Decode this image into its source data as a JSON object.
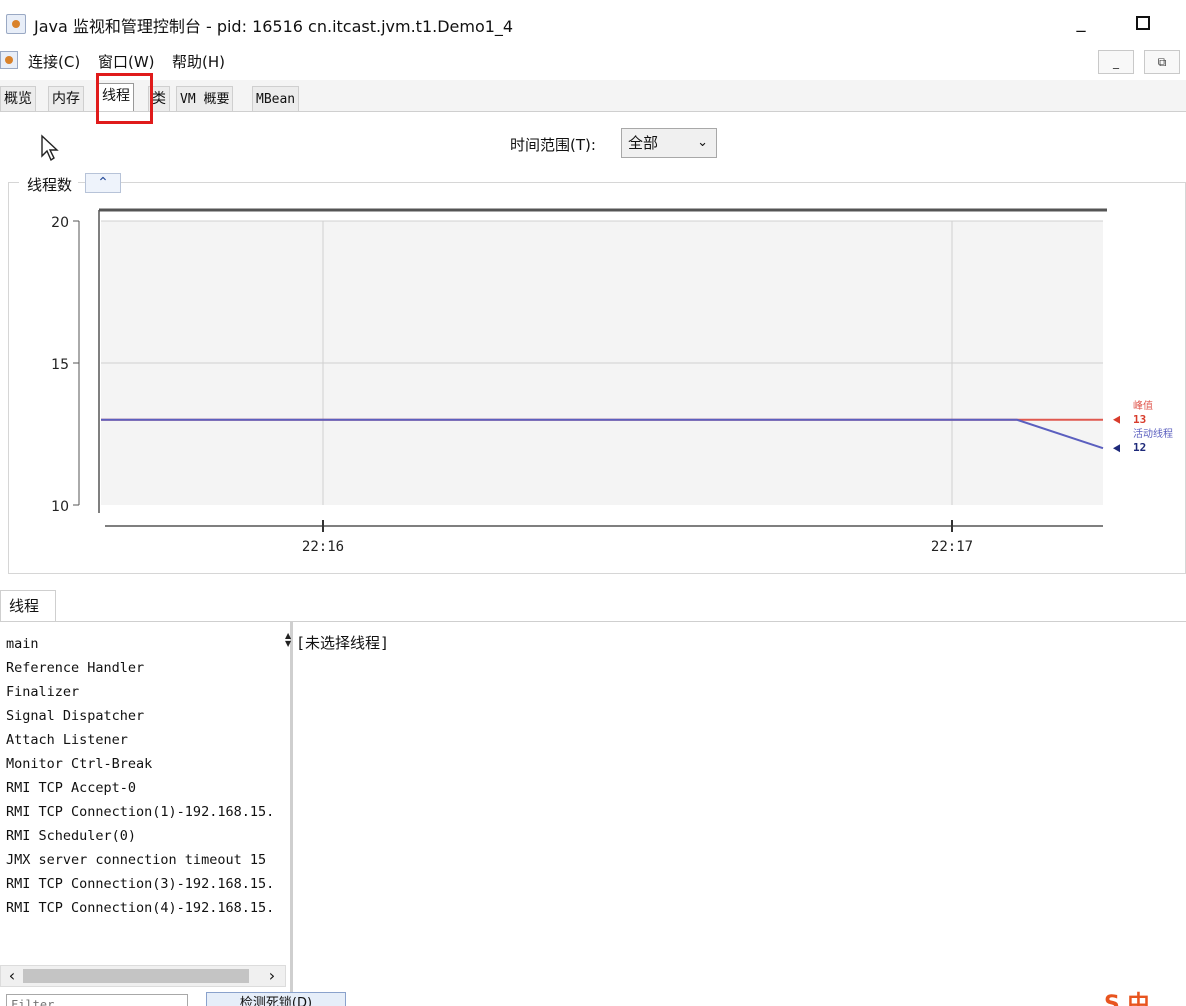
{
  "window": {
    "title": "Java 监视和管理控制台 - pid: 16516 cn.itcast.jvm.t1.Demo1_4",
    "minimize": "_",
    "maximize": ""
  },
  "menu": {
    "connect": "连接(C)",
    "window": "窗口(W)",
    "help": "帮助(H)"
  },
  "mdi_controls": {
    "minimize": "_",
    "restore": "⧉"
  },
  "tabs": {
    "overview": "概览",
    "memory": "内存",
    "threads": "线程",
    "classes": "类",
    "vm_summary": "VM 概要",
    "mbean": "MBean",
    "active": "threads"
  },
  "time_range": {
    "label": "时间范围(T):",
    "selected": "全部"
  },
  "chart_panel": {
    "title": "线程数",
    "collapse_glyph": "⌃"
  },
  "chart_data": {
    "type": "line",
    "ylim": [
      10,
      20
    ],
    "y_ticks": [
      10,
      15,
      20
    ],
    "x_ticks": [
      "22:16",
      "22:17"
    ],
    "grid": true,
    "legend_placement": "right",
    "series": [
      {
        "name": "峰值",
        "color": "#e0584f",
        "points": [
          [
            "start",
            13
          ],
          [
            "22:17+",
            13
          ],
          [
            "end",
            13
          ]
        ],
        "current": "13"
      },
      {
        "name": "活动线程",
        "color": "#5b5fbf",
        "points": [
          [
            "start",
            13
          ],
          [
            "22:17+",
            13
          ],
          [
            "end",
            12
          ]
        ],
        "current": "12"
      }
    ]
  },
  "threads_panel": {
    "tab_label": "线程",
    "threads": [
      "main",
      "Reference Handler",
      "Finalizer",
      "Signal Dispatcher",
      "Attach Listener",
      "Monitor Ctrl-Break",
      "RMI TCP Accept-0",
      "RMI TCP Connection(1)-192.168.15.",
      "RMI Scheduler(0)",
      "JMX server connection timeout 15",
      "RMI TCP Connection(3)-192.168.15.",
      "RMI TCP Connection(4)-192.168.15."
    ],
    "details_placeholder": "[未选择线程]",
    "filter_placeholder": "Filter",
    "detect_deadlock_label": "检测死锁(D)"
  },
  "ime_badge": "S 中"
}
